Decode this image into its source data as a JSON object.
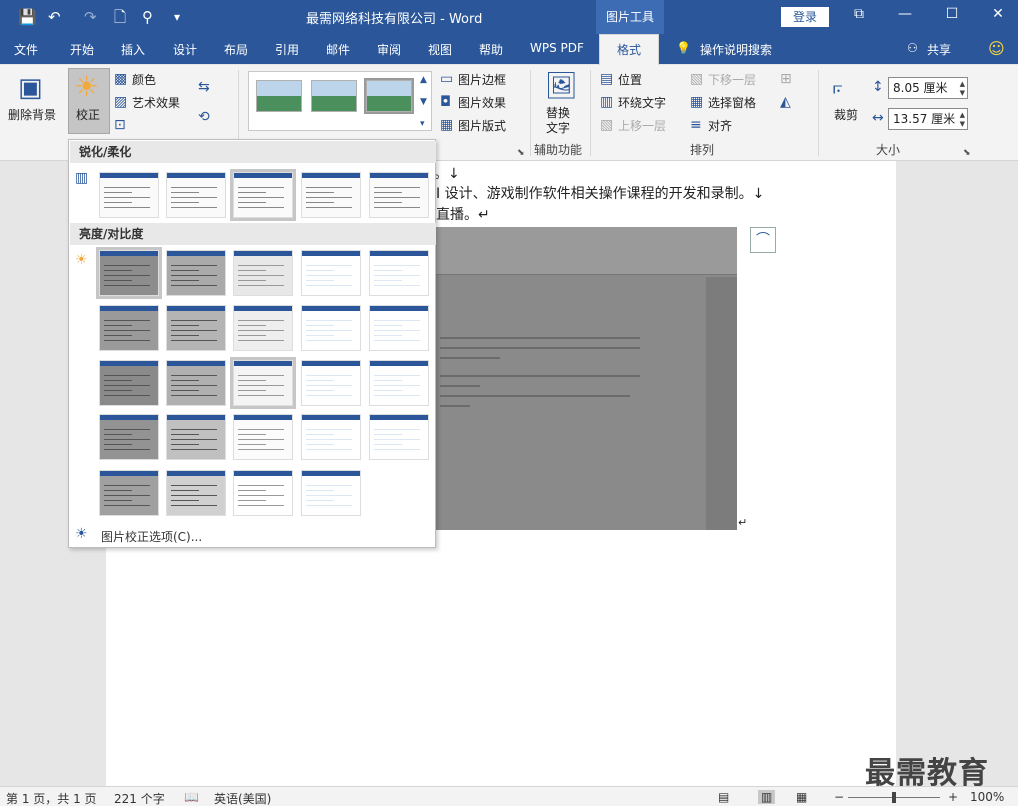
{
  "titlebar": {
    "doc_title": "最需网络科技有限公司 - Word",
    "context_tab": "图片工具",
    "login": "登录",
    "qa_save": "💾",
    "qa_undo": "↶",
    "qa_redo": "↷",
    "qa_new": "🗋",
    "qa_find": "⚲",
    "qa_more": "▾",
    "win_ribbon": "⧉",
    "win_min": "—",
    "win_max": "☐",
    "win_close": "✕"
  },
  "tabs": [
    "文件",
    "开始",
    "插入",
    "设计",
    "布局",
    "引用",
    "邮件",
    "审阅",
    "视图",
    "帮助",
    "WPS PDF"
  ],
  "format_tab": "格式",
  "tell_me": "操作说明搜索",
  "share": "共享",
  "ribbon": {
    "remove_bg": "删除背景",
    "corrections": "校正",
    "color": "颜色",
    "artistic": "艺术效果",
    "picture_border": "图片边框",
    "picture_effects": "图片效果",
    "picture_layout": "图片版式",
    "alt_text_1": "替换",
    "alt_text_2": "文字",
    "accessibility": "辅助功能",
    "position": "位置",
    "wrap_text": "环绕文字",
    "bring_forward": "上移一层",
    "send_backward": "下移一层",
    "selection_pane": "选择窗格",
    "align": "对齐",
    "arrange": "排列",
    "crop": "裁剪",
    "height": "8.05 厘米",
    "width": "13.57 厘米",
    "size": "大小"
  },
  "panel": {
    "sharpen_title": "锐化/柔化",
    "brightness_title": "亮度/对比度",
    "options": "图片校正选项(C)..."
  },
  "doc": {
    "line1": "。↓",
    "line2": "I 设计、游戏制作软件相关操作课程的开发和录制。↓",
    "line3": "直播。↵",
    "end_mark": "↵"
  },
  "status": {
    "page": "第 1 页，共 1 页",
    "words": "221 个字",
    "lang": "英语(美国)",
    "zoom": "100%"
  },
  "watermark": "最需教育",
  "colors": {
    "brand": "#2b579a",
    "ribbon_bg": "#f3f3f3"
  }
}
